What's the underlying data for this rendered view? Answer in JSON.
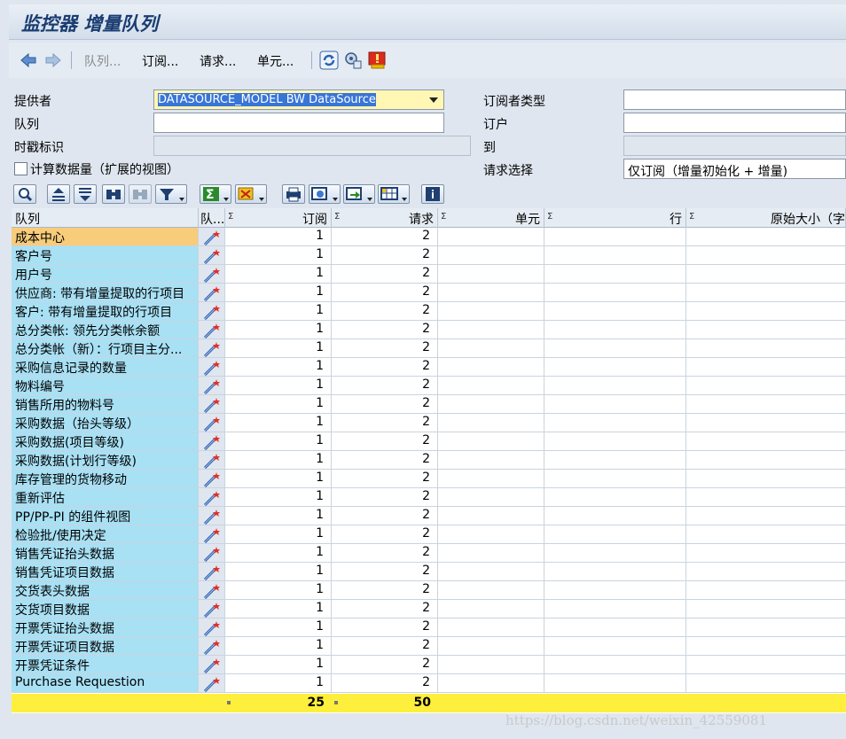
{
  "window": {
    "title": "监控器 增量队列"
  },
  "toolbar": {
    "back_icon": "back-arrow-icon",
    "forward_icon": "forward-arrow-icon",
    "queue_label": "队列...",
    "subscription_label": "订阅...",
    "request_label": "请求...",
    "unit_label": "单元...",
    "refresh_icon": "refresh-icon",
    "settings_icon": "settings-icon",
    "alert_icon": "alert-icon"
  },
  "form": {
    "provider_label": "提供者",
    "provider_value": "DATASOURCE_MODEL BW DataSource",
    "queue_label": "队列",
    "queue_value": "",
    "timestamp_label": "时戳标识",
    "timestamp_value": "",
    "calc_data_label": "计算数据量（扩展的视图）",
    "subscriber_type_label": "订阅者类型",
    "subscriber_type_value": "",
    "subscriber_label": "订户",
    "subscriber_value": "",
    "to_label": "到",
    "to_value": "",
    "request_selection_label": "请求选择",
    "request_selection_value": "仅订阅（增量初始化 + 增量)"
  },
  "grid": {
    "headers": {
      "queue": "队列",
      "queue_short": "队...",
      "subscriptions": "订阅",
      "requests": "请求",
      "units": "单元",
      "rows": "行",
      "original_size": "原始大小（字"
    },
    "rows": [
      {
        "queue": "成本中心",
        "subscriptions": "1",
        "requests": "2"
      },
      {
        "queue": "客户号",
        "subscriptions": "1",
        "requests": "2"
      },
      {
        "queue": "用户号",
        "subscriptions": "1",
        "requests": "2"
      },
      {
        "queue": "供应商: 带有增量提取的行项目",
        "subscriptions": "1",
        "requests": "2"
      },
      {
        "queue": "客户: 带有增量提取的行项目",
        "subscriptions": "1",
        "requests": "2"
      },
      {
        "queue": "总分类帐: 领先分类帐余额",
        "subscriptions": "1",
        "requests": "2"
      },
      {
        "queue": "总分类帐（新）：行项目主分...",
        "subscriptions": "1",
        "requests": "2"
      },
      {
        "queue": "采购信息记录的数量",
        "subscriptions": "1",
        "requests": "2"
      },
      {
        "queue": "物料编号",
        "subscriptions": "1",
        "requests": "2"
      },
      {
        "queue": "销售所用的物料号",
        "subscriptions": "1",
        "requests": "2"
      },
      {
        "queue": "采购数据（抬头等级）",
        "subscriptions": "1",
        "requests": "2"
      },
      {
        "queue": "采购数据(项目等级)",
        "subscriptions": "1",
        "requests": "2"
      },
      {
        "queue": "采购数据(计划行等级)",
        "subscriptions": "1",
        "requests": "2"
      },
      {
        "queue": "库存管理的货物移动",
        "subscriptions": "1",
        "requests": "2"
      },
      {
        "queue": "重新评估",
        "subscriptions": "1",
        "requests": "2"
      },
      {
        "queue": "PP/PP-PI 的组件视图",
        "subscriptions": "1",
        "requests": "2"
      },
      {
        "queue": "检验批/使用决定",
        "subscriptions": "1",
        "requests": "2"
      },
      {
        "queue": "销售凭证抬头数据",
        "subscriptions": "1",
        "requests": "2"
      },
      {
        "queue": "销售凭证项目数据",
        "subscriptions": "1",
        "requests": "2"
      },
      {
        "queue": "交货表头数据",
        "subscriptions": "1",
        "requests": "2"
      },
      {
        "queue": "交货项目数据",
        "subscriptions": "1",
        "requests": "2"
      },
      {
        "queue": "开票凭证抬头数据",
        "subscriptions": "1",
        "requests": "2"
      },
      {
        "queue": "开票凭证项目数据",
        "subscriptions": "1",
        "requests": "2"
      },
      {
        "queue": "开票凭证条件",
        "subscriptions": "1",
        "requests": "2"
      },
      {
        "queue": "Purchase Requestion",
        "subscriptions": "1",
        "requests": "2"
      }
    ],
    "totals": {
      "subscriptions": "25",
      "requests": "50"
    }
  },
  "watermark": "https://blog.csdn.net/weixin_42559081",
  "colors": {
    "title": "#1a3d72",
    "queue_cell": "#a8e0f4",
    "selected_cell": "#f7cc7a",
    "total_row": "#ffef3d",
    "field_selected": "#fff7b3"
  }
}
